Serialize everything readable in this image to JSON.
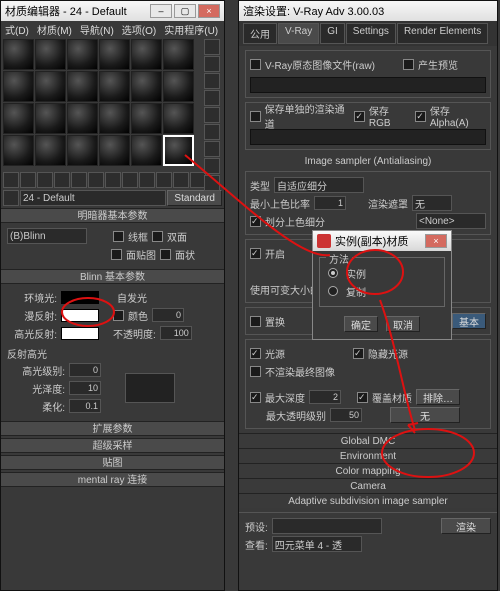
{
  "left": {
    "title": "材质编辑器 - 24 - Default",
    "menu": [
      "式(D)",
      "材质(M)",
      "导航(N)",
      "选项(O)",
      "实用程序(U)"
    ],
    "name_dd": "24 - Default",
    "type_btn": "Standard",
    "sec_shader": "明暗器基本参数",
    "shader_dd": "(B)Blinn",
    "chk_wire": "线框",
    "chk_2side": "双面",
    "chk_facemap": "面贴图",
    "chk_facet": "面状",
    "sec_blinn": "Blinn 基本参数",
    "ambient": "环境光:",
    "diffuse": "漫反射:",
    "specular": "高光反射:",
    "selfillum": "自发光",
    "color": "颜色",
    "opacity": "不透明度:",
    "opacity_v": "100",
    "sec_spec": "反射高光",
    "spec_level": "高光级别:",
    "spec_v": "0",
    "gloss": "光泽度:",
    "gloss_v": "10",
    "soft": "柔化:",
    "soft_v": "0.1",
    "sec_ext": "扩展参数",
    "sec_ss": "超级采样",
    "sec_maps": "贴图",
    "sec_mray": "mental ray 连接"
  },
  "right": {
    "title": "渲染设置: V-Ray Adv 3.00.03",
    "tabs": [
      "公用",
      "V-Ray",
      "GI",
      "Settings",
      "Render Elements"
    ],
    "raw_lbl": "V-Ray原态图像文件(raw)",
    "preview": "产生预览",
    "save_sep": "保存单独的渲染通道",
    "save_rgb": "保存 RGB",
    "save_alpha": "保存Alpha(A)",
    "aa_hdr": "Image sampler  (Antialiasing)",
    "type_lbl": "类型",
    "type_dd": "自适应细分",
    "minrate": "最小上色比率",
    "minrate_v": "1",
    "filter_lbl": "渲染遮罩",
    "filter_dd": "无",
    "div": "划分上色细分",
    "none": "<None>",
    "on": "开启",
    "resize": "使用可变大小的",
    "replace": "置换",
    "replace_btn": "基本",
    "light": "光源",
    "hidden": "隐藏光源",
    "noself": "不渲染最终图像",
    "maxdepth": "最大深度",
    "maxdepth_v": "2",
    "override_mat": "覆盖材质",
    "exclude": "排除…",
    "maxtransp": "最大透明级别",
    "maxtransp_v": "50",
    "none2": "无",
    "gdmc": "Global DMC",
    "env": "Environment",
    "cmap": "Color mapping",
    "cam": "Camera",
    "adap": "Adaptive subdivision image sampler",
    "preset": "预设:",
    "view": "查看:",
    "view_dd": "四元菜单 4 - 透",
    "render": "渲染"
  },
  "dlg": {
    "title": "实例(副本)材质",
    "method": "方法",
    "inst": "实例",
    "copy": "复制",
    "ok": "确定",
    "cancel": "取消"
  }
}
